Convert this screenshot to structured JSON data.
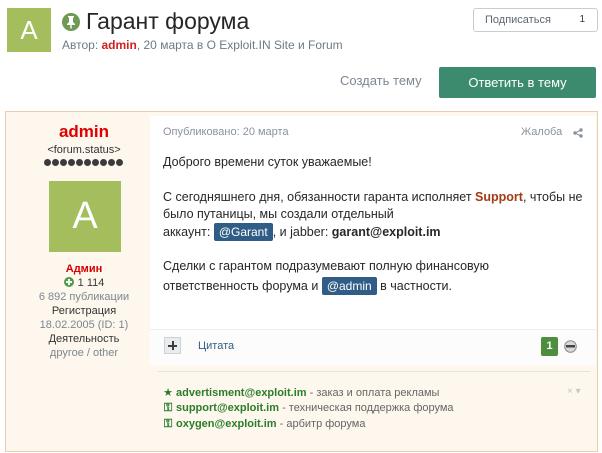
{
  "header": {
    "avatar_letter": "A",
    "title": "Гарант форума",
    "byline_prefix": "Автор: ",
    "author": "admin",
    "byline_suffix": ", 20 марта в O Exploit.IN Site и Forum"
  },
  "subscribe": {
    "label": "Подписаться",
    "count": "1"
  },
  "actions": {
    "create_topic": "Создать тему",
    "reply": "Ответить в тему"
  },
  "author_panel": {
    "name": "admin",
    "status": "<forum.status>",
    "avatar_letter": "A",
    "group": "Админ",
    "reputation": "1 114",
    "posts": "6 892 публикации",
    "registration_label": "Регистрация",
    "registration_value": "18.02.2005 (ID: 1)",
    "activity_label": "Деятельность",
    "activity_value": "другое / other"
  },
  "post": {
    "published": "Опубликовано: 20 марта",
    "report": "Жалоба",
    "greeting": "Доброго времени суток уважаемые!",
    "p1_a": "С сегодняшнего дня, обязанности гаранта исполняет ",
    "p1_support": "Support",
    "p1_b": ", чтобы не",
    "p1_line2": "было путаницы, мы создали отдельный",
    "p1_line3_a": "аккаунт: ",
    "p1_mention": "@Garant",
    "p1_line3_b": ", и jabber: ",
    "p1_jabber": "garant@exploit.im",
    "p2_line1": " Сделки с гарантом подразумевают полную финансовую",
    "p2_line2_a": "ответственность форума и ",
    "p2_mention": "@admin",
    "p2_line2_b": " в частности."
  },
  "post_controls": {
    "quote": "Цитата",
    "likes": "1"
  },
  "signature": [
    {
      "icon": "star",
      "email": "advertisment@exploit.im",
      "desc": " - заказ и оплата рекламы"
    },
    {
      "icon": "jabber",
      "email": "support@exploit.im",
      "desc": " - техническая поддержка форума"
    },
    {
      "icon": "jabber",
      "email": "oxygen@exploit.im",
      "desc": " - арбитр форума"
    }
  ],
  "signature_controls": "× ▾",
  "colors": {
    "accent_green": "#3d8b6e",
    "admin_red": "#e00000",
    "mention_blue": "#2f5d86",
    "avatar_green": "#a4bd5d"
  }
}
